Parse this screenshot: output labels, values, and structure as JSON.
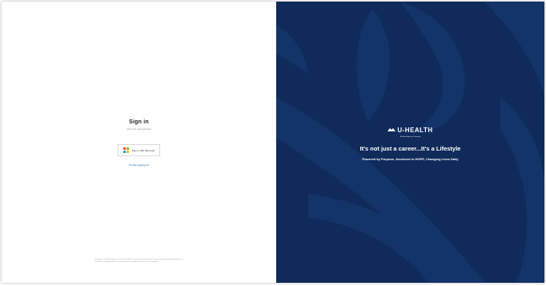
{
  "signin": {
    "title": "Sign in",
    "subtitle": "with your work account",
    "microsoft_button": "Sign in with Microsoft",
    "trouble_link": "Trouble logging in?"
  },
  "footer": {
    "copyright": "Copyright © 2025 All rights reserved. U-Health is a brand name for products and services offered by Provident Life Insurance Company of America and National Foundation Life Insurance Company."
  },
  "brand": {
    "logo_text": "U-HEALTH",
    "logo_subtext": "A Global Agency Company",
    "headline": "It's not just a career...It's a Lifestyle",
    "tagline": "Powered by Purpose, Anchored in HOPE, Changing Lives Daily"
  },
  "colors": {
    "panel_background": "#0f2a5b",
    "ms_red": "#f25022",
    "ms_green": "#7fba00",
    "ms_blue": "#00a4ef",
    "ms_yellow": "#ffb900"
  },
  "icons": {
    "microsoft": "microsoft-logo-icon",
    "brand_mark": "eagle-icon"
  }
}
